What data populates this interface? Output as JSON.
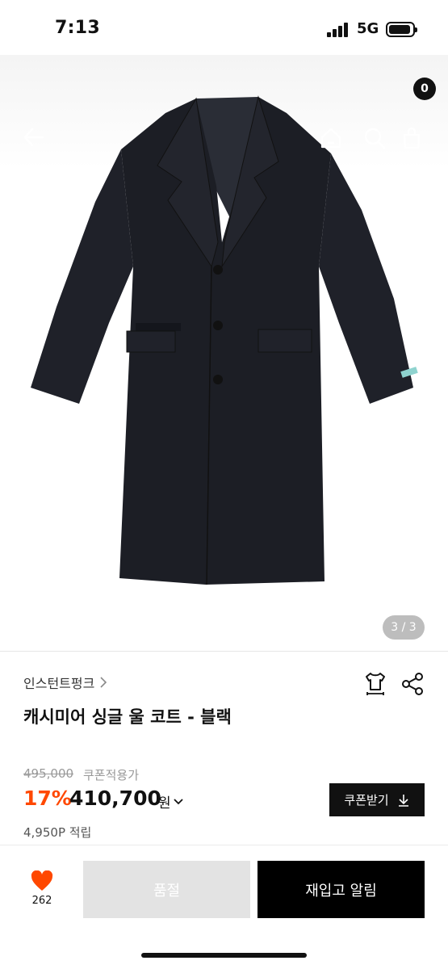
{
  "status_bar": {
    "time": "7:13",
    "network": "5G"
  },
  "header": {
    "cart_count": "0"
  },
  "gallery": {
    "page_indicator": "3 / 3"
  },
  "product": {
    "brand": "인스턴트펑크",
    "title": "캐시미어 싱글 울 코트 - 블랙",
    "original_price": "495,000",
    "coupon_price_label": "쿠폰적용가",
    "discount": "17%",
    "price": "410,700",
    "currency": "원",
    "points": "4,950P 적립"
  },
  "actions": {
    "coupon_button": "쿠폰받기",
    "like_count": "262",
    "soldout_button": "품절",
    "restock_button": "재입고 알림"
  },
  "colors": {
    "accent": "#ff4800",
    "like": "#ff4800",
    "primary": "#000000",
    "disabled": "#e3e3e3"
  },
  "icons": [
    "back-arrow-icon",
    "home-icon",
    "search-icon",
    "cart-icon",
    "chevron-right-icon",
    "size-guide-icon",
    "share-icon",
    "chevron-down-icon",
    "download-icon",
    "heart-icon"
  ]
}
